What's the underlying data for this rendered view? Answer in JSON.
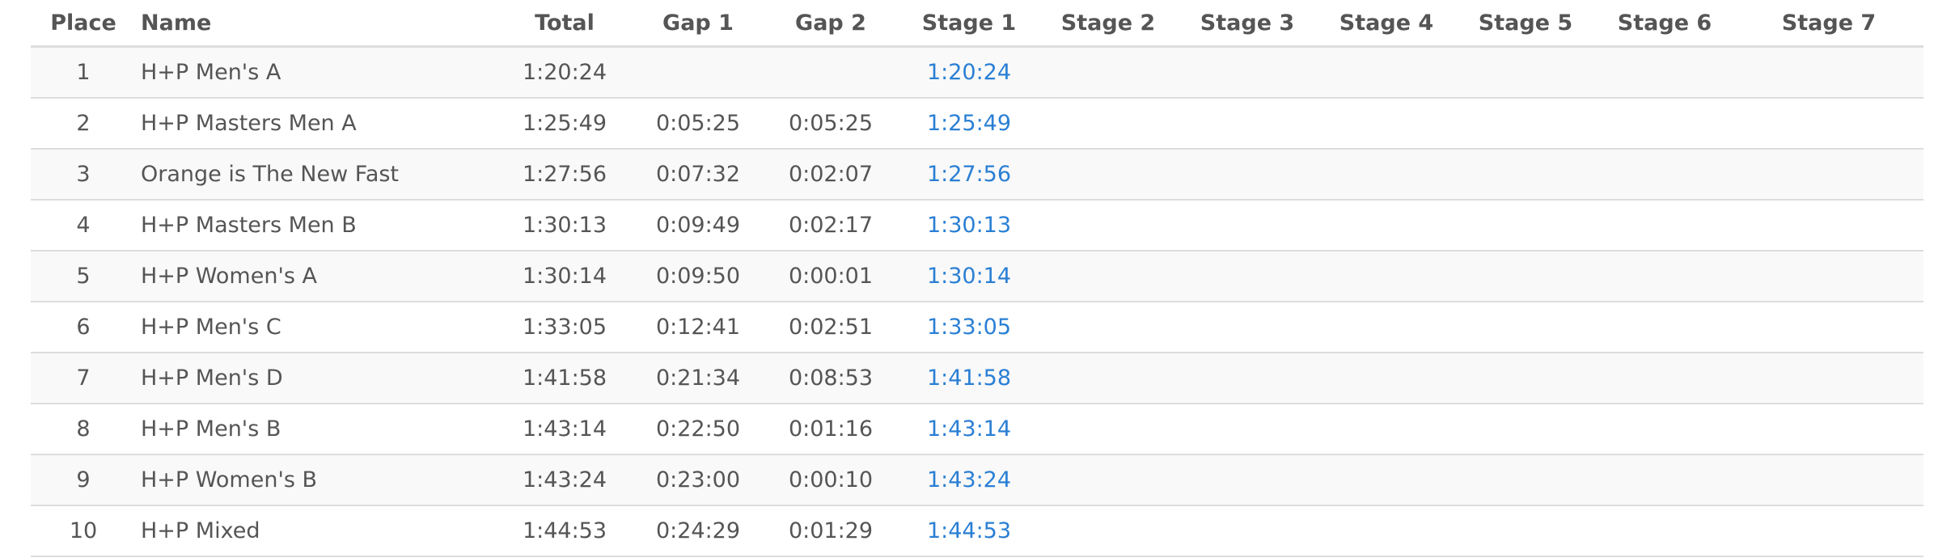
{
  "table": {
    "headers": [
      "Place",
      "Name",
      "Total",
      "Gap 1",
      "Gap 2",
      "Stage 1",
      "Stage 2",
      "Stage 3",
      "Stage 4",
      "Stage 5",
      "Stage 6",
      "Stage 7"
    ],
    "rows": [
      {
        "place": "1",
        "name": "H+P Men's A",
        "total": "1:20:24",
        "gap1": "",
        "gap2": "",
        "stage1": "1:20:24"
      },
      {
        "place": "2",
        "name": "H+P Masters Men A",
        "total": "1:25:49",
        "gap1": "0:05:25",
        "gap2": "0:05:25",
        "stage1": "1:25:49"
      },
      {
        "place": "3",
        "name": "Orange is The New Fast",
        "total": "1:27:56",
        "gap1": "0:07:32",
        "gap2": "0:02:07",
        "stage1": "1:27:56"
      },
      {
        "place": "4",
        "name": "H+P Masters Men B",
        "total": "1:30:13",
        "gap1": "0:09:49",
        "gap2": "0:02:17",
        "stage1": "1:30:13"
      },
      {
        "place": "5",
        "name": "H+P Women's A",
        "total": "1:30:14",
        "gap1": "0:09:50",
        "gap2": "0:00:01",
        "stage1": "1:30:14"
      },
      {
        "place": "6",
        "name": "H+P Men's C",
        "total": "1:33:05",
        "gap1": "0:12:41",
        "gap2": "0:02:51",
        "stage1": "1:33:05"
      },
      {
        "place": "7",
        "name": "H+P Men's D",
        "total": "1:41:58",
        "gap1": "0:21:34",
        "gap2": "0:08:53",
        "stage1": "1:41:58"
      },
      {
        "place": "8",
        "name": "H+P Men's B",
        "total": "1:43:14",
        "gap1": "0:22:50",
        "gap2": "0:01:16",
        "stage1": "1:43:14"
      },
      {
        "place": "9",
        "name": "H+P Women's B",
        "total": "1:43:24",
        "gap1": "0:23:00",
        "gap2": "0:00:10",
        "stage1": "1:43:24"
      },
      {
        "place": "10",
        "name": "H+P Mixed",
        "total": "1:44:53",
        "gap1": "0:24:29",
        "gap2": "0:01:29",
        "stage1": "1:44:53"
      }
    ]
  },
  "colors": {
    "link": "#2a7fd4",
    "text": "#555555",
    "row_stripe": "#f9f9f9",
    "border": "#dddddd"
  }
}
